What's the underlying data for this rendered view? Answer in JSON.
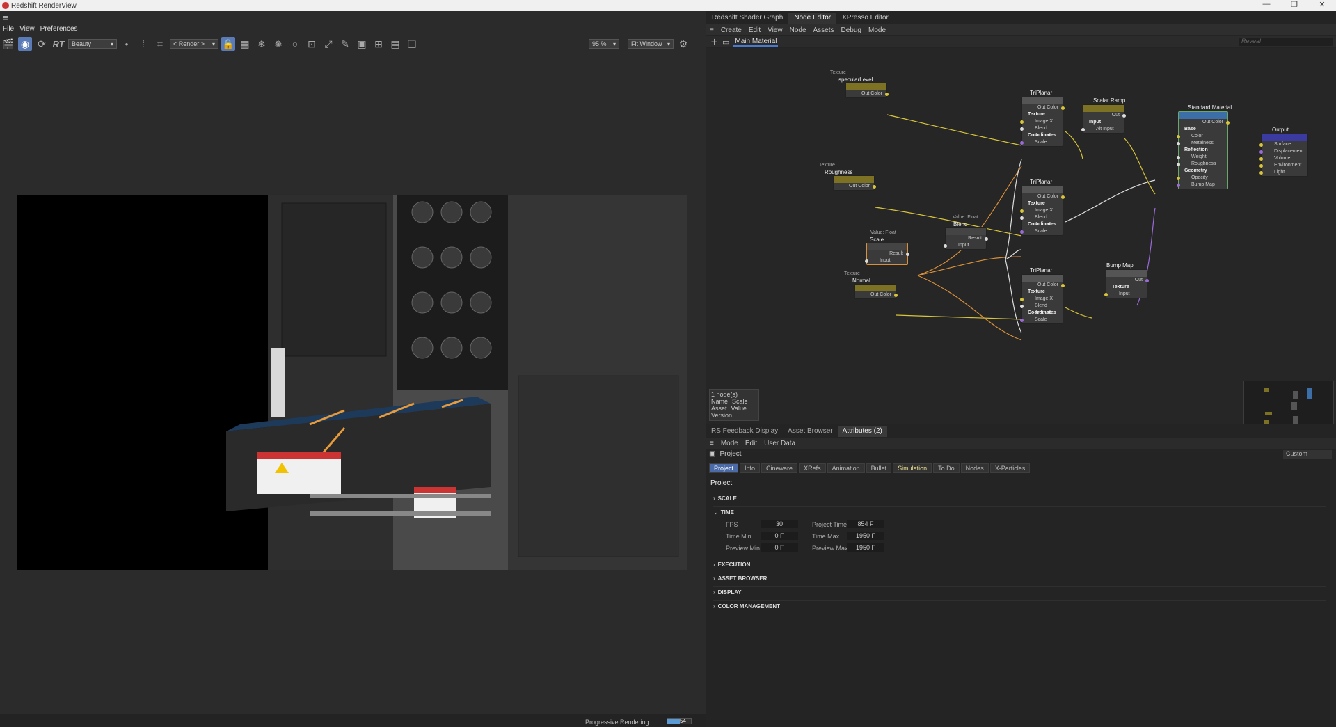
{
  "window": {
    "title": "Redshift RenderView"
  },
  "left": {
    "menu": [
      "File",
      "View",
      "Preferences"
    ],
    "aov": "Beauty",
    "rgb": "RGB",
    "render_target": "< Render >",
    "zoom": "95 %",
    "fit": "Fit Window",
    "status": "Progressive Rendering...",
    "progress_value": 0.54,
    "progress_label": "54"
  },
  "right": {
    "tabs": [
      "Redshift Shader Graph",
      "Node Editor",
      "XPresso Editor"
    ],
    "menu": [
      "Create",
      "Edit",
      "View",
      "Node",
      "Assets",
      "Debug",
      "Mode"
    ],
    "breadcrumb": "Main Material",
    "search_placeholder": "Reveal",
    "info": {
      "count": "1 node(s)",
      "name_label": "Name",
      "name_value": "Scale",
      "asset_label": "Asset",
      "asset_value": "Value",
      "version_label": "Version"
    },
    "bottom_tabs": [
      "RS Feedback Display",
      "Asset Browser",
      "Attributes (2)"
    ],
    "attr_menu": [
      "Mode",
      "Edit",
      "User Data"
    ],
    "project_label": "Project",
    "custom": "Custom",
    "project_tabs": [
      "Project",
      "Info",
      "Cineware",
      "XRefs",
      "Animation",
      "Bullet",
      "Simulation",
      "To Do",
      "Nodes",
      "X-Particles"
    ],
    "project_title": "Project",
    "sections": {
      "scale": "SCALE",
      "time": "TIME",
      "execution": "EXECUTION",
      "asset_browser": "ASSET BROWSER",
      "display": "DISPLAY",
      "color_management": "COLOR MANAGEMENT"
    },
    "time": {
      "fps_label": "FPS",
      "fps": "30",
      "project_time_label": "Project Time",
      "project_time": "854 F",
      "time_min_label": "Time Min",
      "time_min": "0 F",
      "time_max_label": "Time Max",
      "time_max": "1950 F",
      "preview_min_label": "Preview Min",
      "preview_min": "0 F",
      "preview_max_label": "Preview Max",
      "preview_max": "1950 F"
    }
  },
  "nodes": {
    "spec": {
      "type": "Texture",
      "name": "specularLevel",
      "out": "Out Color"
    },
    "rough": {
      "type": "Texture",
      "name": "Roughness",
      "out": "Out Color"
    },
    "normal": {
      "type": "Texture",
      "name": "Normal",
      "out": "Out Color"
    },
    "scale": {
      "type": "Value: Float",
      "name": "Scale",
      "in": "Input",
      "out": "Result"
    },
    "blend": {
      "type": "Value: Float",
      "name": "Blend",
      "in": "Input",
      "out": "Result"
    },
    "tp": {
      "name": "TriPlanar",
      "out": "Out Color",
      "texture": "Texture",
      "imagex": "Image X",
      "blend": "Blend Amount",
      "coords": "Coordinates",
      "scale": "Scale"
    },
    "ramp": {
      "name": "Scalar Ramp",
      "out": "Out",
      "input": "Input",
      "alt": "Alt Input"
    },
    "bump": {
      "name": "Bump Map",
      "out": "Out",
      "texture": "Texture",
      "input": "Input"
    },
    "std": {
      "name": "Standard Material",
      "out": "Out Color",
      "base": "Base",
      "color": "Color",
      "metal": "Metalness",
      "refl": "Reflection",
      "weight": "Weight",
      "rough": "Roughness",
      "geo": "Geometry",
      "opacity": "Opacity",
      "bumpmap": "Bump Map"
    },
    "output": {
      "name": "Output",
      "surface": "Surface",
      "disp": "Displacement",
      "volume": "Volume",
      "env": "Environment",
      "light": "Light"
    }
  },
  "colors": {
    "accent": "#4a7ad0",
    "texture_header": "#7d7224",
    "std_header": "#3c6ea8",
    "output_header": "#3a3aa0",
    "wire_yellow": "#d8c53a",
    "wire_orange": "#d9903a",
    "wire_purple": "#9a6ad8"
  }
}
